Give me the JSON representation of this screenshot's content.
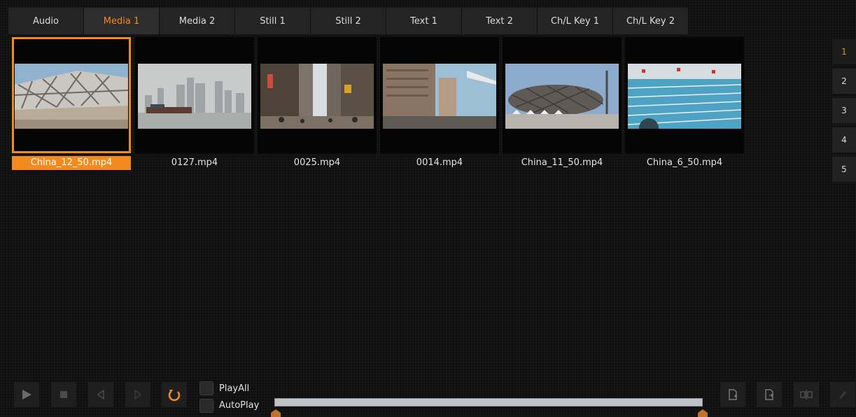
{
  "tabs": [
    {
      "label": "Audio",
      "active": false
    },
    {
      "label": "Media 1",
      "active": true
    },
    {
      "label": "Media 2",
      "active": false
    },
    {
      "label": "Still 1",
      "active": false
    },
    {
      "label": "Still 2",
      "active": false
    },
    {
      "label": "Text 1",
      "active": false
    },
    {
      "label": "Text 2",
      "active": false
    },
    {
      "label": "Ch/L Key 1",
      "active": false
    },
    {
      "label": "Ch/L Key 2",
      "active": false
    }
  ],
  "media": [
    {
      "filename": "China_12_50.mp4",
      "selected": true
    },
    {
      "filename": "0127.mp4",
      "selected": false
    },
    {
      "filename": "0025.mp4",
      "selected": false
    },
    {
      "filename": "0014.mp4",
      "selected": false
    },
    {
      "filename": "China_11_50.mp4",
      "selected": false
    },
    {
      "filename": "China_6_50.mp4",
      "selected": false
    }
  ],
  "pages": [
    "1",
    "2",
    "3",
    "4",
    "5"
  ],
  "active_page": "1",
  "controls": {
    "play_all_label": "PlayAll",
    "auto_play_label": "AutoPlay",
    "play_all_checked": false,
    "auto_play_checked": false
  },
  "colors": {
    "accent": "#f28a1e",
    "background": "#101010",
    "tab": "#242424"
  },
  "icons": [
    "play-icon",
    "stop-icon",
    "previous-icon",
    "next-icon",
    "loop-icon",
    "import-icon",
    "export-icon",
    "split-icon",
    "edit-icon"
  ]
}
